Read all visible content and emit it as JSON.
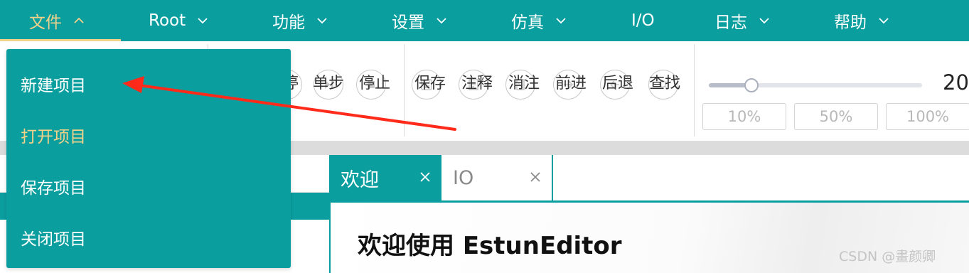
{
  "menubar": {
    "items": [
      {
        "label": "文件"
      },
      {
        "label": "Root"
      },
      {
        "label": "功能"
      },
      {
        "label": "设置"
      },
      {
        "label": "仿真"
      },
      {
        "label": "I/O"
      },
      {
        "label": "日志"
      },
      {
        "label": "帮助"
      }
    ],
    "active_color": "#f3d28a",
    "bg_color": "#0b9e9f"
  },
  "toolbar": {
    "run_group": [
      {
        "label": "停",
        "icon": "pause-icon"
      },
      {
        "label": "单步",
        "icon": "step-icon"
      },
      {
        "label": "停止",
        "icon": "stop-icon"
      }
    ],
    "edit_group": [
      {
        "label": "保存",
        "icon": "save-icon"
      },
      {
        "label": "注释",
        "icon": "comment-icon"
      },
      {
        "label": "消注",
        "icon": "uncomment-icon"
      },
      {
        "label": "前进",
        "icon": "forward-icon"
      },
      {
        "label": "后退",
        "icon": "back-icon"
      },
      {
        "label": "查找",
        "icon": "search-icon"
      }
    ],
    "zoom": {
      "value_text": "20",
      "slider_fraction": 0.2,
      "presets": [
        "10%",
        "50%",
        "100%"
      ]
    }
  },
  "tabs": [
    {
      "label": "欢迎",
      "active": true
    },
    {
      "label": "IO",
      "active": false
    }
  ],
  "content": {
    "heading": "欢迎使用 EstunEditor",
    "watermark": "CSDN @畫颜卿"
  },
  "dropdown": {
    "items": [
      {
        "label": "新建项目"
      },
      {
        "label": "打开项目"
      },
      {
        "label": "保存项目"
      },
      {
        "label": "关闭项目"
      }
    ],
    "hover_color": "#f3d28a"
  },
  "annotation": {
    "arrow_color": "#ff2a1a"
  }
}
